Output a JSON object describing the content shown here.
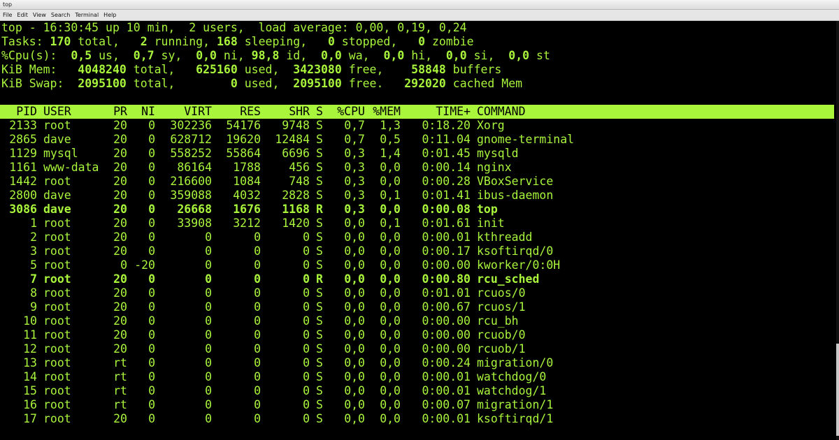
{
  "window": {
    "title": "top"
  },
  "menu": [
    "File",
    "Edit",
    "View",
    "Search",
    "Terminal",
    "Help"
  ],
  "summary": [
    [
      {
        "t": "top - 16:30:45 up 10 min,  2 users,  load average: 0,00, 0,19, 0,24"
      }
    ],
    [
      {
        "t": "Tasks: "
      },
      {
        "t": "170",
        "b": true
      },
      {
        "t": " total,   "
      },
      {
        "t": "2",
        "b": true
      },
      {
        "t": " running, "
      },
      {
        "t": "168",
        "b": true
      },
      {
        "t": " sleeping,   "
      },
      {
        "t": "0",
        "b": true
      },
      {
        "t": " stopped,   "
      },
      {
        "t": "0",
        "b": true
      },
      {
        "t": " zombie"
      }
    ],
    [
      {
        "t": "%Cpu(s):  "
      },
      {
        "t": "0,5",
        "b": true
      },
      {
        "t": " us,  "
      },
      {
        "t": "0,7",
        "b": true
      },
      {
        "t": " sy,  "
      },
      {
        "t": "0,0",
        "b": true
      },
      {
        "t": " ni, "
      },
      {
        "t": "98,8",
        "b": true
      },
      {
        "t": " id,  "
      },
      {
        "t": "0,0",
        "b": true
      },
      {
        "t": " wa,  "
      },
      {
        "t": "0,0",
        "b": true
      },
      {
        "t": " hi,  "
      },
      {
        "t": "0,0",
        "b": true
      },
      {
        "t": " si,  "
      },
      {
        "t": "0,0",
        "b": true
      },
      {
        "t": " st"
      }
    ],
    [
      {
        "t": "KiB Mem:   "
      },
      {
        "t": "4048240",
        "b": true
      },
      {
        "t": " total,   "
      },
      {
        "t": "625160",
        "b": true
      },
      {
        "t": " used,  "
      },
      {
        "t": "3423080",
        "b": true
      },
      {
        "t": " free,    "
      },
      {
        "t": "58848",
        "b": true
      },
      {
        "t": " buffers"
      }
    ],
    [
      {
        "t": "KiB Swap:  "
      },
      {
        "t": "2095100",
        "b": true
      },
      {
        "t": " total,        "
      },
      {
        "t": "0",
        "b": true
      },
      {
        "t": " used,  "
      },
      {
        "t": "2095100",
        "b": true
      },
      {
        "t": " free.   "
      },
      {
        "t": "292020",
        "b": true
      },
      {
        "t": " cached Mem"
      }
    ]
  ],
  "columns": {
    "pid": "PID",
    "user": "USER",
    "pr": "PR",
    "ni": "NI",
    "virt": "VIRT",
    "res": "RES",
    "shr": "SHR",
    "s": "S",
    "cpu": "%CPU",
    "mem": "%MEM",
    "time": "TIME+",
    "command": "COMMAND"
  },
  "processes": [
    {
      "pid": "2133",
      "user": "root",
      "pr": "20",
      "ni": "0",
      "virt": "302236",
      "res": "54176",
      "shr": "9748",
      "s": "S",
      "cpu": "0,7",
      "mem": "1,3",
      "time": "0:18.20",
      "command": "Xorg"
    },
    {
      "pid": "2865",
      "user": "dave",
      "pr": "20",
      "ni": "0",
      "virt": "628712",
      "res": "19620",
      "shr": "12484",
      "s": "S",
      "cpu": "0,7",
      "mem": "0,5",
      "time": "0:11.04",
      "command": "gnome-terminal"
    },
    {
      "pid": "1129",
      "user": "mysql",
      "pr": "20",
      "ni": "0",
      "virt": "558252",
      "res": "55864",
      "shr": "6696",
      "s": "S",
      "cpu": "0,3",
      "mem": "1,4",
      "time": "0:01.45",
      "command": "mysqld"
    },
    {
      "pid": "1161",
      "user": "www-data",
      "pr": "20",
      "ni": "0",
      "virt": "86164",
      "res": "1788",
      "shr": "456",
      "s": "S",
      "cpu": "0,3",
      "mem": "0,0",
      "time": "0:00.14",
      "command": "nginx"
    },
    {
      "pid": "1442",
      "user": "root",
      "pr": "20",
      "ni": "0",
      "virt": "216600",
      "res": "1084",
      "shr": "748",
      "s": "S",
      "cpu": "0,3",
      "mem": "0,0",
      "time": "0:00.28",
      "command": "VBoxService"
    },
    {
      "pid": "2800",
      "user": "dave",
      "pr": "20",
      "ni": "0",
      "virt": "359088",
      "res": "4032",
      "shr": "2828",
      "s": "S",
      "cpu": "0,3",
      "mem": "0,1",
      "time": "0:01.41",
      "command": "ibus-daemon"
    },
    {
      "pid": "3086",
      "user": "dave",
      "pr": "20",
      "ni": "0",
      "virt": "26668",
      "res": "1676",
      "shr": "1168",
      "s": "R",
      "cpu": "0,3",
      "mem": "0,0",
      "time": "0:00.08",
      "command": "top",
      "bold": true
    },
    {
      "pid": "1",
      "user": "root",
      "pr": "20",
      "ni": "0",
      "virt": "33908",
      "res": "3212",
      "shr": "1420",
      "s": "S",
      "cpu": "0,0",
      "mem": "0,1",
      "time": "0:01.61",
      "command": "init"
    },
    {
      "pid": "2",
      "user": "root",
      "pr": "20",
      "ni": "0",
      "virt": "0",
      "res": "0",
      "shr": "0",
      "s": "S",
      "cpu": "0,0",
      "mem": "0,0",
      "time": "0:00.01",
      "command": "kthreadd"
    },
    {
      "pid": "3",
      "user": "root",
      "pr": "20",
      "ni": "0",
      "virt": "0",
      "res": "0",
      "shr": "0",
      "s": "S",
      "cpu": "0,0",
      "mem": "0,0",
      "time": "0:00.17",
      "command": "ksoftirqd/0"
    },
    {
      "pid": "5",
      "user": "root",
      "pr": "0",
      "ni": "-20",
      "virt": "0",
      "res": "0",
      "shr": "0",
      "s": "S",
      "cpu": "0,0",
      "mem": "0,0",
      "time": "0:00.00",
      "command": "kworker/0:0H"
    },
    {
      "pid": "7",
      "user": "root",
      "pr": "20",
      "ni": "0",
      "virt": "0",
      "res": "0",
      "shr": "0",
      "s": "R",
      "cpu": "0,0",
      "mem": "0,0",
      "time": "0:00.80",
      "command": "rcu_sched",
      "bold": true
    },
    {
      "pid": "8",
      "user": "root",
      "pr": "20",
      "ni": "0",
      "virt": "0",
      "res": "0",
      "shr": "0",
      "s": "S",
      "cpu": "0,0",
      "mem": "0,0",
      "time": "0:01.01",
      "command": "rcuos/0"
    },
    {
      "pid": "9",
      "user": "root",
      "pr": "20",
      "ni": "0",
      "virt": "0",
      "res": "0",
      "shr": "0",
      "s": "S",
      "cpu": "0,0",
      "mem": "0,0",
      "time": "0:00.67",
      "command": "rcuos/1"
    },
    {
      "pid": "10",
      "user": "root",
      "pr": "20",
      "ni": "0",
      "virt": "0",
      "res": "0",
      "shr": "0",
      "s": "S",
      "cpu": "0,0",
      "mem": "0,0",
      "time": "0:00.00",
      "command": "rcu_bh"
    },
    {
      "pid": "11",
      "user": "root",
      "pr": "20",
      "ni": "0",
      "virt": "0",
      "res": "0",
      "shr": "0",
      "s": "S",
      "cpu": "0,0",
      "mem": "0,0",
      "time": "0:00.00",
      "command": "rcuob/0"
    },
    {
      "pid": "12",
      "user": "root",
      "pr": "20",
      "ni": "0",
      "virt": "0",
      "res": "0",
      "shr": "0",
      "s": "S",
      "cpu": "0,0",
      "mem": "0,0",
      "time": "0:00.00",
      "command": "rcuob/1"
    },
    {
      "pid": "13",
      "user": "root",
      "pr": "rt",
      "ni": "0",
      "virt": "0",
      "res": "0",
      "shr": "0",
      "s": "S",
      "cpu": "0,0",
      "mem": "0,0",
      "time": "0:00.24",
      "command": "migration/0"
    },
    {
      "pid": "14",
      "user": "root",
      "pr": "rt",
      "ni": "0",
      "virt": "0",
      "res": "0",
      "shr": "0",
      "s": "S",
      "cpu": "0,0",
      "mem": "0,0",
      "time": "0:00.01",
      "command": "watchdog/0"
    },
    {
      "pid": "15",
      "user": "root",
      "pr": "rt",
      "ni": "0",
      "virt": "0",
      "res": "0",
      "shr": "0",
      "s": "S",
      "cpu": "0,0",
      "mem": "0,0",
      "time": "0:00.01",
      "command": "watchdog/1"
    },
    {
      "pid": "16",
      "user": "root",
      "pr": "rt",
      "ni": "0",
      "virt": "0",
      "res": "0",
      "shr": "0",
      "s": "S",
      "cpu": "0,0",
      "mem": "0,0",
      "time": "0:00.07",
      "command": "migration/1"
    },
    {
      "pid": "17",
      "user": "root",
      "pr": "20",
      "ni": "0",
      "virt": "0",
      "res": "0",
      "shr": "0",
      "s": "S",
      "cpu": "0,0",
      "mem": "0,0",
      "time": "0:00.01",
      "command": "ksoftirqd/1"
    }
  ],
  "colors": {
    "terminal_fg": "#a9f53c",
    "terminal_bg": "#000000",
    "header_bg": "#a9f53c"
  }
}
